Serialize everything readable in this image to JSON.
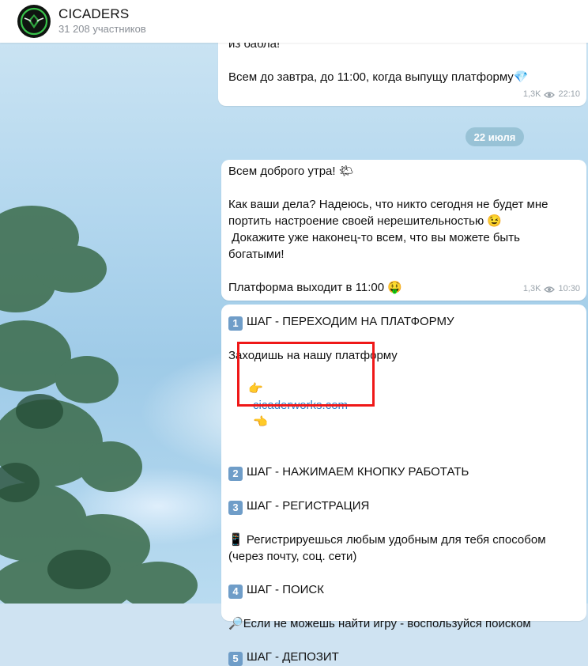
{
  "header": {
    "title": "CICADERS",
    "subtitle": "31 208 участников",
    "avatar_icon": "cicada-logo-icon"
  },
  "messages": [
    {
      "partial_text": "из бабла!",
      "text": "Всем до завтра, до 11:00, когда выпущу платформу💎",
      "views": "1,3K",
      "time": "22:10"
    },
    {
      "date_label": "22 июля"
    },
    {
      "line1": "Всем доброго утра! 🌤",
      "line2": "Как ваши дела? Надеюсь, что никто сегодня не будет мне",
      "line3": "портить настроение своей нерешительностью 😉",
      "line4": " Докажите уже наконец-то всем, что вы можете быть",
      "line5": "богатыми!",
      "line6": "Платформа выходит в 11:00 🤑",
      "views": "1,3K",
      "time": "10:30"
    },
    {
      "step1_num": "1",
      "step1": "ШАГ - ПЕРЕХОДИМ НА ПЛАТФОРМУ",
      "step1_desc": "Заходишь на нашу платформу",
      "link_left": "👉",
      "link": "cicaderworks.com",
      "link_right": "👈",
      "step2_num": "2",
      "step2": "ШАГ - НАЖИМАЕМ КНОПКУ РАБОТАТЬ",
      "step3_num": "3",
      "step3": "ШАГ - РЕГИСТРАЦИЯ",
      "step3_icon": "📱",
      "step3_desc1": "Регистрируешься любым удобным для тебя способом",
      "step3_desc2": "(через почту, соц. сети)",
      "step4_num": "4",
      "step4": "ШАГ - ПОИСК",
      "step4_icon": "🔎",
      "step4_desc": "Если не можешь найти игру - воспользуйся поиском",
      "step5_num": "5",
      "step5": "ШАГ - ДЕПОЗИТ"
    }
  ],
  "colors": {
    "highlight": "#ef1818",
    "link": "#2a7fc7",
    "header_bg": "#ffffff"
  }
}
